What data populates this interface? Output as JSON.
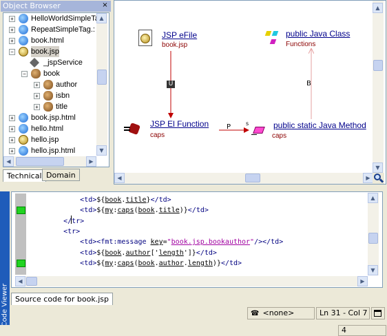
{
  "object_browser": {
    "title": "Object Browser",
    "close": "×",
    "items": [
      {
        "label": "HelloWorldSimpleTa",
        "icon": "ie-icon",
        "expander": "+",
        "level": 0
      },
      {
        "label": "RepeatSimpleTag.:",
        "icon": "ie-icon",
        "expander": "+",
        "level": 0
      },
      {
        "label": "book.html",
        "icon": "ie-icon",
        "expander": "+",
        "level": 0
      },
      {
        "label": "book.jsp",
        "icon": "jsp-icon",
        "expander": "−",
        "level": 0,
        "selected": true
      },
      {
        "label": "_jspService",
        "icon": "method-icon",
        "expander": "",
        "level": 1
      },
      {
        "label": "book",
        "icon": "bean-icon",
        "expander": "−",
        "level": 1
      },
      {
        "label": "author",
        "icon": "bean-icon",
        "expander": "+",
        "level": 2
      },
      {
        "label": "isbn",
        "icon": "bean-icon",
        "expander": "+",
        "level": 2
      },
      {
        "label": "title",
        "icon": "bean-icon",
        "expander": "+",
        "level": 2
      },
      {
        "label": "book.jsp.html",
        "icon": "ie-icon",
        "expander": "+",
        "level": 0
      },
      {
        "label": "hello.html",
        "icon": "ie-icon",
        "expander": "+",
        "level": 0
      },
      {
        "label": "hello.jsp",
        "icon": "jsp-icon",
        "expander": "+",
        "level": 0
      },
      {
        "label": "hello.jsp.html",
        "icon": "ie-icon",
        "expander": "+",
        "level": 0
      }
    ],
    "tabs": [
      "Technical",
      "Domain"
    ]
  },
  "diagram": {
    "nodes": {
      "efile": {
        "title": "JSP eFile",
        "sub": "book.jsp"
      },
      "java_class": {
        "title": "public Java Class",
        "sub": "Functions"
      },
      "el_function": {
        "title": "JSP El Function",
        "sub": "caps"
      },
      "java_method": {
        "title": "public static Java Method",
        "sub": "caps"
      }
    },
    "edges": {
      "u": "U",
      "p": "P",
      "s": "s",
      "b": "B"
    }
  },
  "code_viewer": {
    "side_label": "Code Viewer",
    "tab": "Source code for book.jsp",
    "lines": [
      {
        "indent": "        ",
        "parts": [
          [
            "tg",
            "<td>"
          ],
          [
            "",
            "${"
          ],
          [
            "ul",
            "book"
          ],
          [
            "",
            "."
          ],
          [
            "ul",
            "title"
          ],
          [
            "",
            "}"
          ],
          [
            "tg",
            "</td>"
          ]
        ],
        "mark": false
      },
      {
        "indent": "        ",
        "parts": [
          [
            "tg",
            "<td>"
          ],
          [
            "",
            "${"
          ],
          [
            "ul",
            "my"
          ],
          [
            "",
            ":"
          ],
          [
            "ul",
            "caps"
          ],
          [
            "",
            "("
          ],
          [
            "ul",
            "book"
          ],
          [
            "",
            "."
          ],
          [
            "ul",
            "title"
          ],
          [
            "",
            ")}"
          ],
          [
            "tg",
            "</td>"
          ]
        ],
        "mark": true
      },
      {
        "indent": "    ",
        "parts": [
          [
            "tg",
            "</tr>"
          ]
        ],
        "mark": false
      },
      {
        "indent": "    ",
        "parts": [
          [
            "tg",
            "<tr>"
          ]
        ],
        "mark": false
      },
      {
        "indent": "        ",
        "parts": [
          [
            "tg",
            "<td><fmt:message "
          ],
          [
            "ul",
            "key"
          ],
          [
            "",
            "="
          ],
          [
            "str",
            "\""
          ],
          [
            "str ul",
            "book.jsp.bookauthor"
          ],
          [
            "str",
            "\""
          ],
          [
            "tg",
            "/></td>"
          ]
        ],
        "mark": false
      },
      {
        "indent": "        ",
        "parts": [
          [
            "tg",
            "<td>"
          ],
          [
            "",
            "${"
          ],
          [
            "ul",
            "book"
          ],
          [
            "",
            "."
          ],
          [
            "ul",
            "author"
          ],
          [
            "",
            "['"
          ],
          [
            "ul",
            "length"
          ],
          [
            "",
            "']}"
          ],
          [
            "tg",
            "</td>"
          ]
        ],
        "mark": false
      },
      {
        "indent": "        ",
        "parts": [
          [
            "tg",
            "<td>"
          ],
          [
            "",
            "${"
          ],
          [
            "ul",
            "my"
          ],
          [
            "",
            ":"
          ],
          [
            "ul",
            "caps"
          ],
          [
            "",
            "("
          ],
          [
            "ul",
            "book"
          ],
          [
            "",
            "."
          ],
          [
            "ul",
            "author"
          ],
          [
            "",
            "."
          ],
          [
            "ul",
            "length"
          ],
          [
            "",
            ")}"
          ],
          [
            "tg",
            "</td>"
          ]
        ],
        "mark": true
      }
    ]
  },
  "status": {
    "mode": "<none>",
    "position": "Ln 31 - Col 7",
    "count": "4"
  }
}
